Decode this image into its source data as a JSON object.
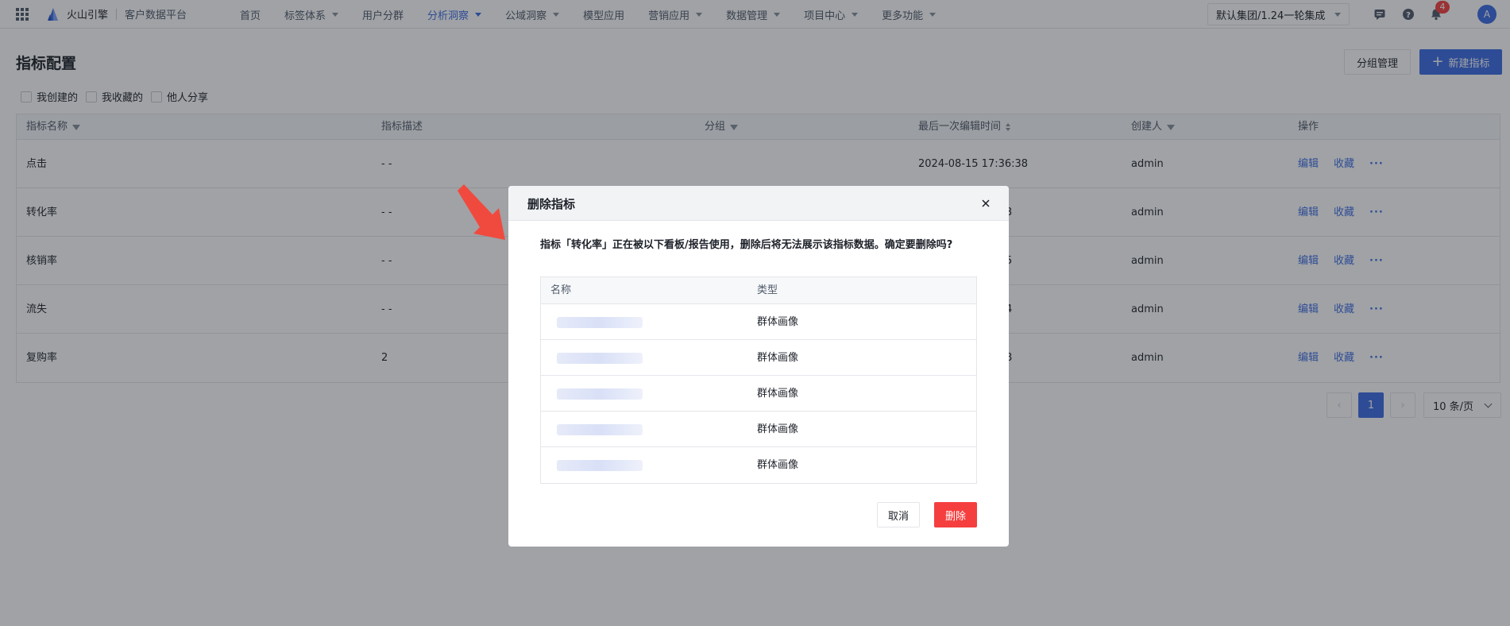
{
  "topbar": {
    "brand": "火山引擎",
    "product": "客户数据平台",
    "nav": [
      {
        "label": "首页",
        "dropdown": false,
        "active": false
      },
      {
        "label": "标签体系",
        "dropdown": true,
        "active": false
      },
      {
        "label": "用户分群",
        "dropdown": false,
        "active": false
      },
      {
        "label": "分析洞察",
        "dropdown": true,
        "active": true
      },
      {
        "label": "公域洞察",
        "dropdown": true,
        "active": false
      },
      {
        "label": "模型应用",
        "dropdown": false,
        "active": false
      },
      {
        "label": "营销应用",
        "dropdown": true,
        "active": false
      },
      {
        "label": "数据管理",
        "dropdown": true,
        "active": false
      },
      {
        "label": "项目中心",
        "dropdown": true,
        "active": false
      },
      {
        "label": "更多功能",
        "dropdown": true,
        "active": false
      }
    ],
    "org_select": "默认集团/1.24一轮集成",
    "notification_count": "4",
    "avatar": "A",
    "accent_color": "#3c6be4"
  },
  "page": {
    "title": "指标配置",
    "group_button": "分组管理",
    "new_button": "新建指标",
    "filters": [
      "我创建的",
      "我收藏的",
      "他人分享"
    ]
  },
  "table": {
    "columns": [
      "指标名称",
      "指标描述",
      "分组",
      "最后一次编辑时间",
      "创建人",
      "操作"
    ],
    "rows": [
      {
        "name": "点击",
        "desc": "- -",
        "time": "2024-08-15 17:36:38",
        "creator": "admin"
      },
      {
        "name": "转化率",
        "desc": "- -",
        "time": "3",
        "creator": "admin"
      },
      {
        "name": "核销率",
        "desc": "- -",
        "time": "5",
        "creator": "admin"
      },
      {
        "name": "流失",
        "desc": "- -",
        "time": "4",
        "creator": "admin"
      },
      {
        "name": "复购率",
        "desc": "2",
        "time": "8",
        "creator": "admin"
      }
    ],
    "action_edit": "编辑",
    "action_fav": "收藏",
    "action_more": "···"
  },
  "pagination": {
    "current": "1",
    "page_size": "10 条/页"
  },
  "modal": {
    "title": "删除指标",
    "message": "指标「转化率」正在被以下看板/报告使用，删除后将无法展示该指标数据。确定要删除吗?",
    "columns": [
      "名称",
      "类型"
    ],
    "rows": [
      {
        "type": "群体画像"
      },
      {
        "type": "群体画像"
      },
      {
        "type": "群体画像"
      },
      {
        "type": "群体画像"
      },
      {
        "type": "群体画像"
      }
    ],
    "cancel": "取消",
    "confirm": "删除",
    "danger_color": "#f53f3f"
  }
}
